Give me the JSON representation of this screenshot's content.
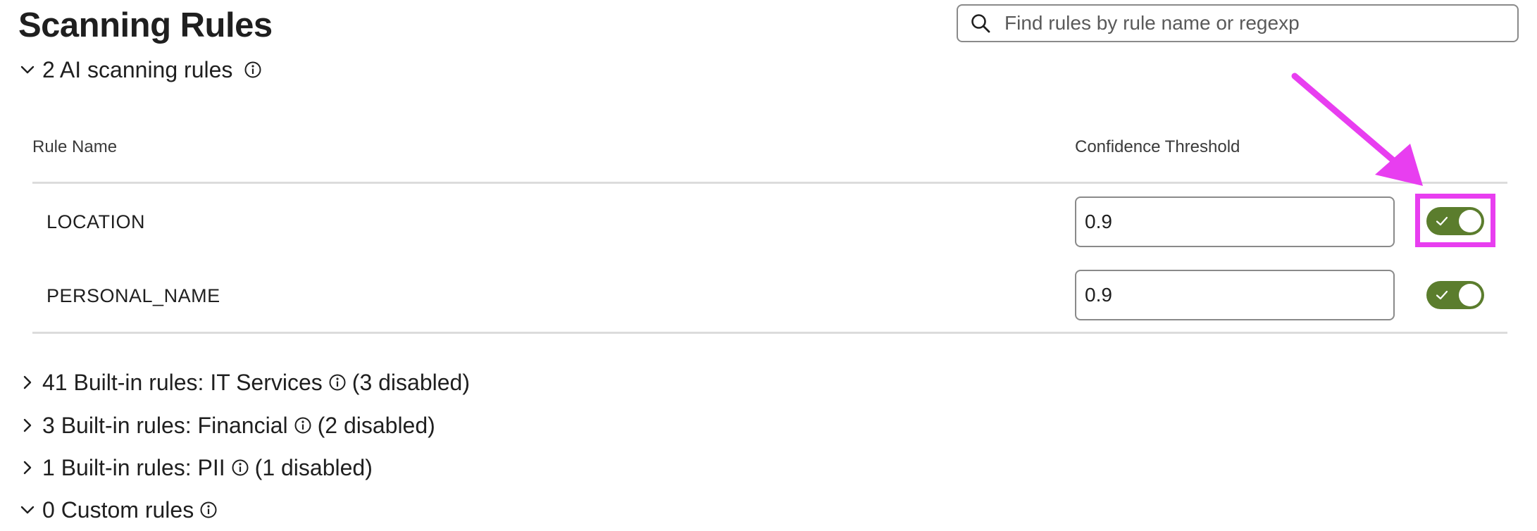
{
  "page": {
    "title": "Scanning Rules"
  },
  "search": {
    "placeholder": "Find rules by rule name or regexp",
    "value": ""
  },
  "ai_section": {
    "label": "2 AI scanning rules",
    "expanded": true
  },
  "table": {
    "columns": {
      "rule_name": "Rule Name",
      "confidence_threshold": "Confidence Threshold"
    },
    "rows": [
      {
        "name": "LOCATION",
        "threshold": "0.9",
        "enabled": true
      },
      {
        "name": "PERSONAL_NAME",
        "threshold": "0.9",
        "enabled": true
      }
    ]
  },
  "sections": [
    {
      "label": "41 Built-in rules: IT Services",
      "suffix": "(3 disabled)",
      "expanded": false
    },
    {
      "label": "3 Built-in rules: Financial",
      "suffix": "(2 disabled)",
      "expanded": false
    },
    {
      "label": "1 Built-in rules: PII",
      "suffix": "(1 disabled)",
      "expanded": false
    },
    {
      "label": "0 Custom rules",
      "suffix": "",
      "expanded": true
    }
  ],
  "colors": {
    "toggle_on": "#5b7d2d",
    "annotation": "#e83ef0",
    "text": "#1f1f1f",
    "divider": "#dcdcdc"
  },
  "icons": {
    "search": "search-icon",
    "info": "info-icon",
    "chevron_down": "chevron-down-icon",
    "chevron_right": "chevron-right-icon",
    "check": "check-icon"
  }
}
